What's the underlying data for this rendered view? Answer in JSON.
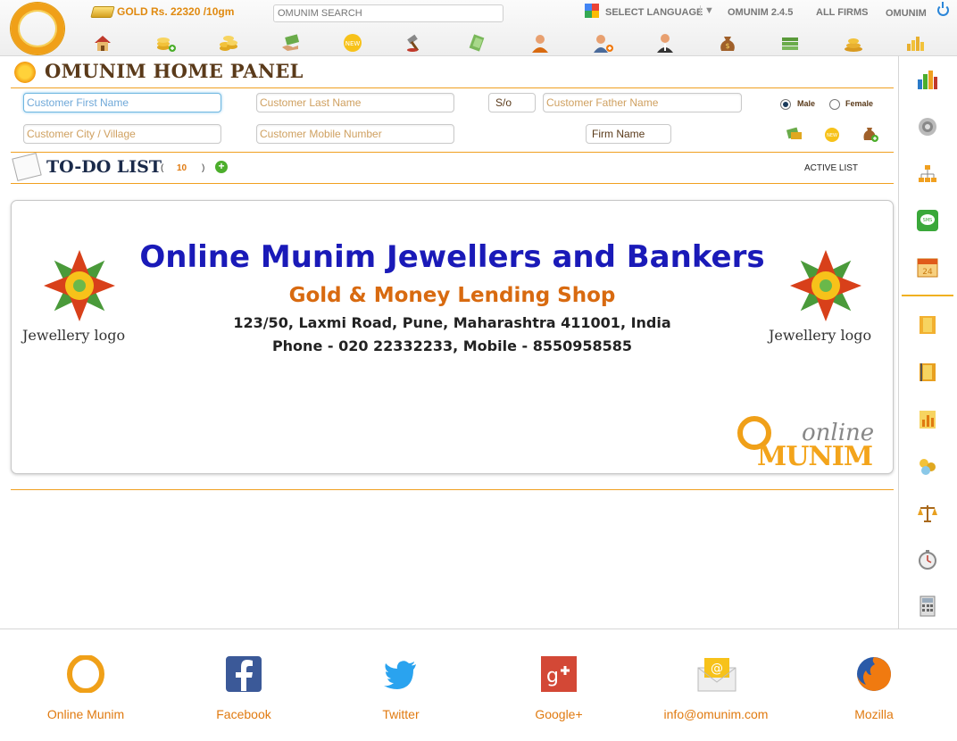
{
  "topbar": {
    "gold_label": "GOLD Rs. 22320 /10gm",
    "search_placeholder": "OMUNIM SEARCH",
    "select_language": "SELECT LANGUAGE",
    "language_caret": "▼",
    "version": "OMUNIM 2.4.5",
    "all_firms": "ALL FIRMS",
    "user": "OMUNIM",
    "icons": [
      "home-icon",
      "add-money-icon",
      "coins-icon",
      "hand-money-icon",
      "new-item-icon",
      "auction-hammer-icon",
      "cash-bag-icon",
      "user-icon",
      "add-user-icon",
      "staff-icon",
      "money-sack-icon",
      "banknotes-icon",
      "gold-stack-icon",
      "gold-bars-icon"
    ]
  },
  "panel": {
    "title": "OMUNIM HOME PANEL"
  },
  "form": {
    "first_name_placeholder": "Customer First Name",
    "last_name_placeholder": "Customer Last Name",
    "so_label": "S/o",
    "father_name_placeholder": "Customer Father Name",
    "male_label": "Male",
    "female_label": "Female",
    "city_placeholder": "Customer City / Village",
    "mobile_placeholder": "Customer Mobile Number",
    "firm_label": "Firm Name",
    "selected_gender": "Male"
  },
  "todo": {
    "title": "TO-DO LIST",
    "paren_open": "(",
    "count": "10",
    "paren_close": ")",
    "add_glyph": "+",
    "active_list": "ACTIVE LIST"
  },
  "card": {
    "logo_label_left": "Jewellery logo",
    "logo_label_right": "Jewellery logo",
    "shop_name": "Online Munim Jewellers and Bankers",
    "shop_subtitle": "Gold & Money Lending Shop",
    "address": "123/50, Laxmi Road, Pune, Maharashtra 411001, India",
    "phone": "Phone - 020 22332233, Mobile - 8550958585",
    "brand_online": "online",
    "brand_munim": "MUNIM"
  },
  "rightbar": {
    "icons": [
      "bar-chart-icon",
      "settings-gear-icon",
      "hierarchy-icon",
      "sms-icon",
      "calendar-icon",
      "film-strip-icon",
      "report-book-icon",
      "column-chart-icon",
      "gold-coins-icon",
      "balance-scale-icon",
      "stopwatch-icon",
      "calculator-icon"
    ]
  },
  "footer": {
    "links": [
      {
        "label": "Online Munim",
        "icon": "omunim-logo-icon"
      },
      {
        "label": "Facebook",
        "icon": "facebook-icon"
      },
      {
        "label": "Twitter",
        "icon": "twitter-icon"
      },
      {
        "label": "Google+",
        "icon": "google-plus-icon"
      },
      {
        "label": "info@omunim.com",
        "icon": "email-icon"
      },
      {
        "label": "Mozilla",
        "icon": "firefox-icon"
      }
    ]
  },
  "colors": {
    "accent_orange": "#f0a020",
    "title_brown": "#5a3a1a",
    "shop_blue": "#1a1ab8",
    "subtitle_orange": "#d86a10",
    "footer_label": "#e07a10"
  }
}
